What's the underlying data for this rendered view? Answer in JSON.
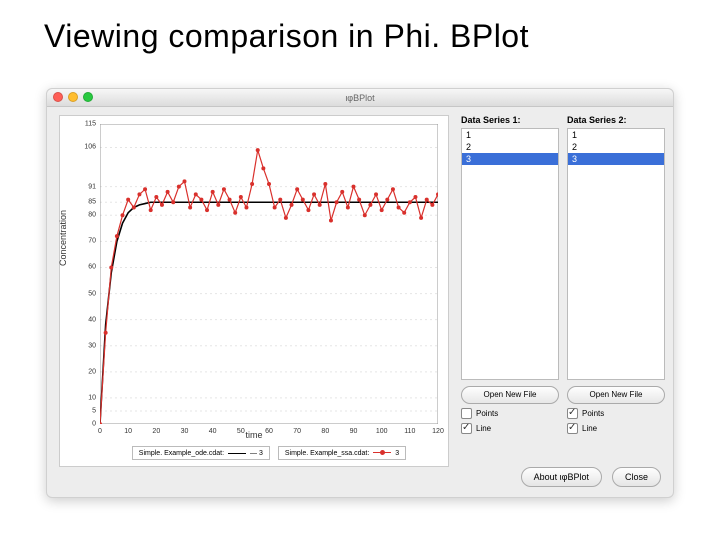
{
  "title": "Viewing comparison in Phi. BPlot",
  "window": {
    "title": "ιφBPlot"
  },
  "series_panels": [
    {
      "label": "Data Series 1:",
      "items": [
        "1",
        "2",
        "3"
      ],
      "selected_index": 2,
      "open_label": "Open New File",
      "points": {
        "label": "Points",
        "checked": false
      },
      "line": {
        "label": "Line",
        "checked": true
      }
    },
    {
      "label": "Data Series 2:",
      "items": [
        "1",
        "2",
        "3"
      ],
      "selected_index": 2,
      "open_label": "Open New File",
      "points": {
        "label": "Points",
        "checked": true
      },
      "line": {
        "label": "Line",
        "checked": true
      }
    }
  ],
  "buttons": {
    "about": "About ιφBPlot",
    "close": "Close"
  },
  "legend": [
    {
      "text": "Simple. Example_ode.cdat:",
      "marker": "— 3"
    },
    {
      "text": "Simple. Example_ssa.cdat:",
      "marker": "● 3"
    }
  ],
  "axes": {
    "xlabel": "time",
    "ylabel": "Concentration"
  },
  "chart_data": {
    "type": "line",
    "title": "",
    "xlabel": "time",
    "ylabel": "Concentration",
    "xlim": [
      0,
      120
    ],
    "ylim": [
      0,
      115
    ],
    "xticks": [
      0,
      10,
      20,
      30,
      40,
      50,
      60,
      70,
      80,
      90,
      100,
      110,
      120
    ],
    "yticks": [
      0,
      5,
      10,
      20,
      30,
      40,
      50,
      60,
      70,
      80,
      85,
      91,
      106,
      115
    ],
    "series": [
      {
        "name": "Simple. Example_ode.cdat: 3",
        "style": "line",
        "color": "#000000",
        "x": [
          0,
          2,
          4,
          6,
          8,
          10,
          12,
          14,
          16,
          18,
          20,
          25,
          30,
          40,
          60,
          80,
          100,
          120
        ],
        "y": [
          0,
          38,
          58,
          70,
          77,
          81,
          83,
          84,
          84.5,
          85,
          85,
          85,
          85,
          85,
          85,
          85,
          85,
          85
        ]
      },
      {
        "name": "Simple. Example_ssa.cdat: 3",
        "style": "linepoints",
        "color": "#d9302c",
        "x": [
          0,
          2,
          4,
          6,
          8,
          10,
          12,
          14,
          16,
          18,
          20,
          22,
          24,
          26,
          28,
          30,
          32,
          34,
          36,
          38,
          40,
          42,
          44,
          46,
          48,
          50,
          52,
          54,
          56,
          58,
          60,
          62,
          64,
          66,
          68,
          70,
          72,
          74,
          76,
          78,
          80,
          82,
          84,
          86,
          88,
          90,
          92,
          94,
          96,
          98,
          100,
          102,
          104,
          106,
          108,
          110,
          112,
          114,
          116,
          118,
          120
        ],
        "y": [
          0,
          35,
          60,
          72,
          80,
          86,
          83,
          88,
          90,
          82,
          87,
          84,
          89,
          85,
          91,
          93,
          83,
          88,
          86,
          82,
          89,
          84,
          90,
          86,
          81,
          87,
          83,
          92,
          105,
          98,
          92,
          83,
          86,
          79,
          84,
          90,
          86,
          82,
          88,
          84,
          92,
          78,
          85,
          89,
          83,
          91,
          86,
          80,
          84,
          88,
          82,
          86,
          90,
          83,
          81,
          85,
          87,
          79,
          86,
          84,
          88
        ]
      }
    ]
  }
}
